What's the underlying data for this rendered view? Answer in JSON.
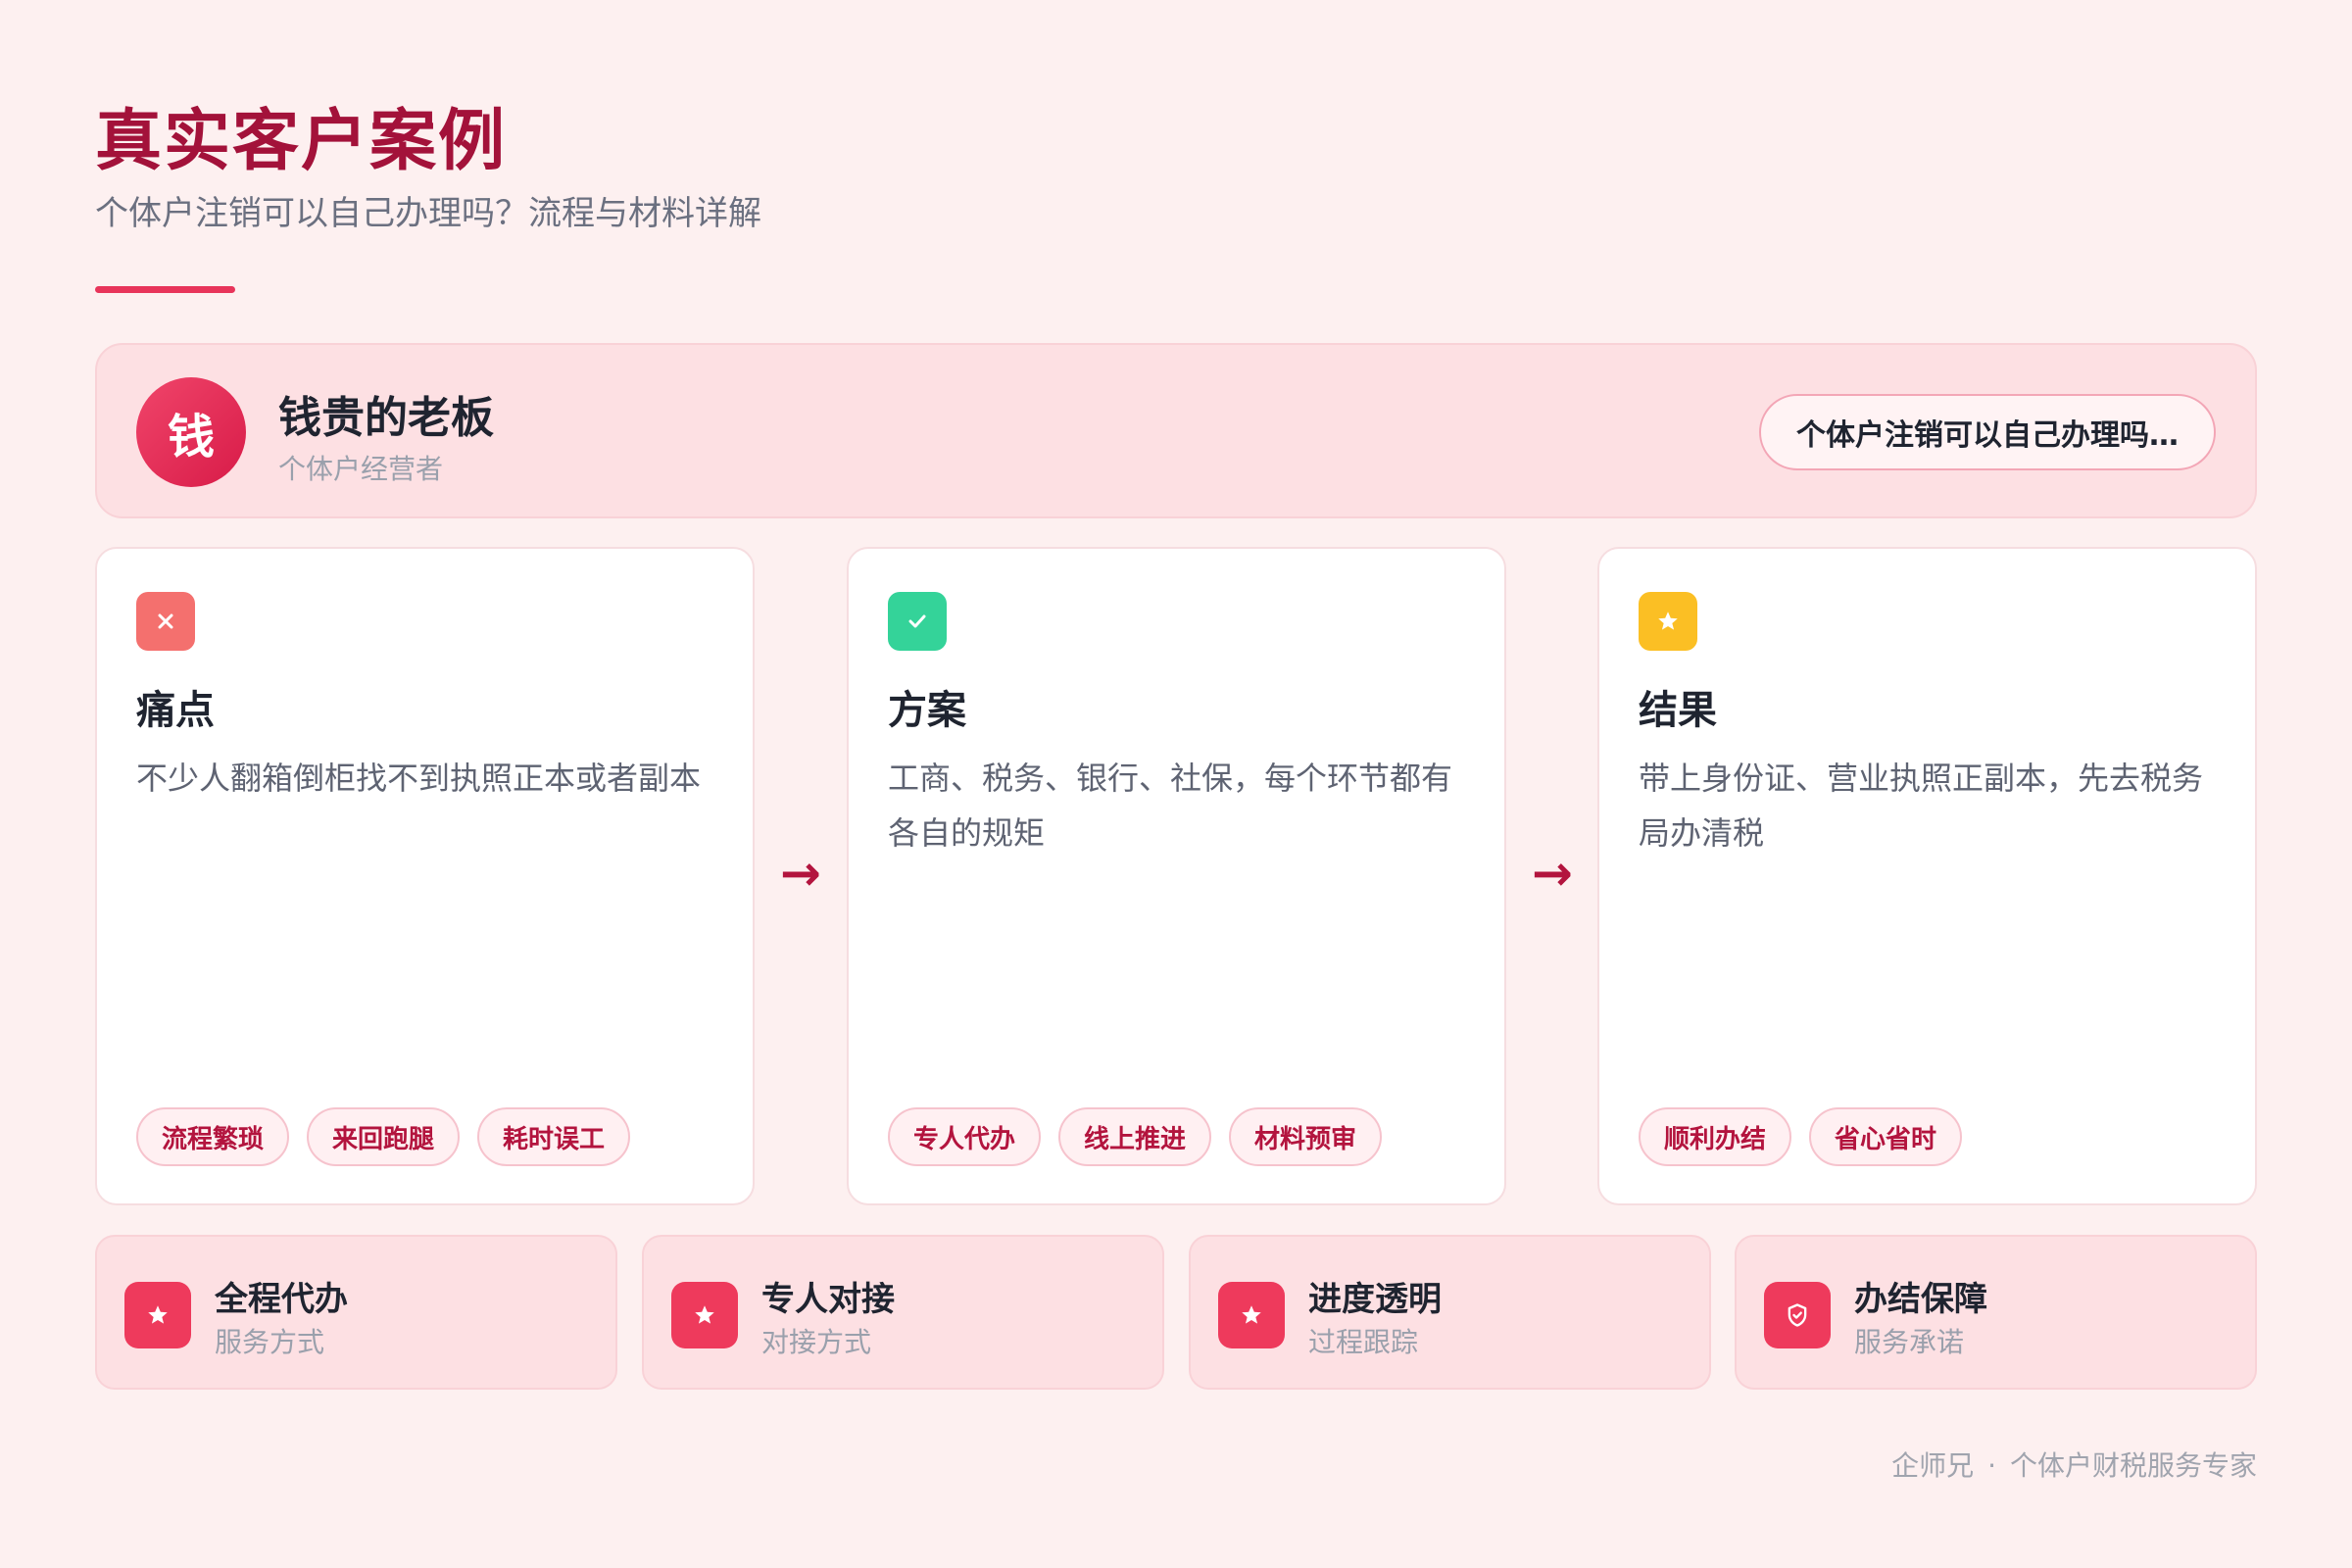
{
  "header": {
    "title": "真实客户案例",
    "subtitle": "个体户注销可以自己办理吗？流程与材料详解"
  },
  "profile": {
    "avatar_char": "钱",
    "name": "钱贵的老板",
    "role": "个体户经营者",
    "topic": "个体户注销可以自己办理吗…"
  },
  "steps": [
    {
      "title": "痛点",
      "icon": "close-icon",
      "color": "#f4706e",
      "text": "不少人翻箱倒柜找不到执照正本或者副本",
      "tags": [
        "流程繁琐",
        "来回跑腿",
        "耗时误工"
      ]
    },
    {
      "title": "方案",
      "icon": "check-icon",
      "color": "#34d399",
      "text": "工商、税务、银行、社保，每个环节都有各自的规矩",
      "tags": [
        "专人代办",
        "线上推进",
        "材料预审"
      ]
    },
    {
      "title": "结果",
      "icon": "star-icon",
      "color": "#fbbf24",
      "text": "带上身份证、营业执照正副本，先去税务局办清税",
      "tags": [
        "顺利办结",
        "省心省时"
      ]
    }
  ],
  "features": [
    {
      "title": "全程代办",
      "sub": "服务方式",
      "icon": "star-icon"
    },
    {
      "title": "专人对接",
      "sub": "对接方式",
      "icon": "star-icon"
    },
    {
      "title": "进度透明",
      "sub": "过程跟踪",
      "icon": "star-icon"
    },
    {
      "title": "办结保障",
      "sub": "服务承诺",
      "icon": "shield-check-icon"
    }
  ],
  "footer": {
    "brand": "企师兄",
    "separator": "·",
    "tagline": "个体户财税服务专家"
  },
  "colors": {
    "accent": "#a3123a",
    "brand": "#e8345a"
  }
}
